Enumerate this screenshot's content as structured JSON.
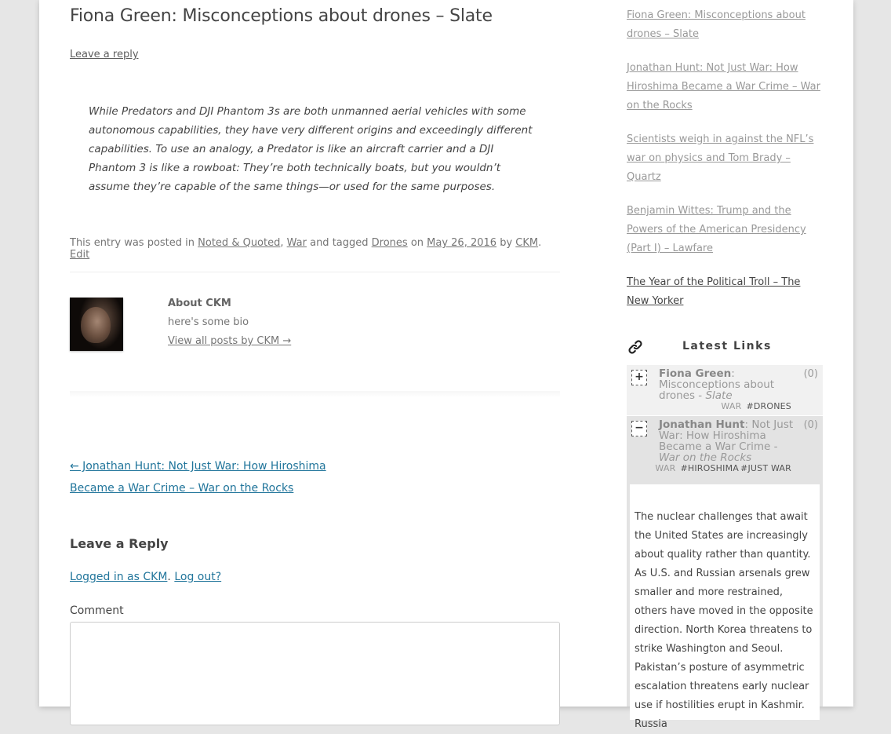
{
  "post": {
    "title": "Fiona Green: Misconceptions about drones – Slate",
    "leave_reply": "Leave a reply",
    "quote": "While Predators and DJI Phantom 3s are both unmanned aerial vehicles with some autonomous capabilities, they have very different origins and exceedingly different capabilities. To use an analogy, a Predator is like an aircraft carrier and a DJI Phantom 3 is like a rowboat: They’re both technically boats, but you wouldn’t assume they’re capable of the same things—or used for the same purposes.",
    "meta": {
      "prefix": "This entry was posted in ",
      "cat1": "Noted & Quoted",
      "sep1": ", ",
      "cat2": "War",
      "tagged": " and tagged ",
      "tag": "Drones",
      "on": " on ",
      "date": "May 26, 2016",
      "by": " by ",
      "author": "CKM",
      "dot": ". ",
      "edit": "Edit"
    }
  },
  "author_box": {
    "title": "About CKM",
    "bio": "here's some bio",
    "view_all": "View all posts by CKM →"
  },
  "nav": {
    "prev": "← Jonathan Hunt: Not Just War: How Hiroshima Became a War Crime – War on the Rocks"
  },
  "reply": {
    "title": "Leave a Reply",
    "logged_in": "Logged in as CKM",
    "dot": ". ",
    "logout": "Log out?",
    "comment_label": "Comment"
  },
  "sidebar": {
    "recent": [
      "Fiona Green: Misconceptions about drones – Slate",
      "Jonathan Hunt: Not Just War: How Hiroshima Became a War Crime – War on the Rocks",
      "Scientists weigh in against the NFL’s war on physics and Tom Brady – Quartz",
      "Benjamin Wittes: Trump and the Powers of the American Presidency (Part I) – Lawfare",
      "The Year of the Political Troll – The New Yorker"
    ],
    "latest_links_title": "Latest Links",
    "links": [
      {
        "toggle": "+",
        "author": "Fiona Green",
        "colon": ":",
        "rest": " Misconceptions about drones - ",
        "source": "Slate",
        "count": "(0)",
        "category": "WAR",
        "tags": [
          "#DRONES"
        ]
      },
      {
        "toggle": "−",
        "author": "Jonathan Hunt",
        "colon": ":",
        "rest": " Not Just War: How Hiroshima Became a War Crime - ",
        "source": "War on the Rocks",
        "count": "(0)",
        "category": "WAR",
        "tags": [
          "#HIROSHIMA",
          "#JUST WAR"
        ],
        "body": "The nuclear challenges that await the United States are increasingly about quality rather than quantity. As U.S. and Russian arsenals grew smaller and more restrained, others have moved in the opposite direction. North Korea threatens to strike Washington and Seoul. Pakistan’s posture of asymmetric escalation threatens early nuclear use if hostilities erupt in Kashmir. Russia"
      }
    ]
  }
}
